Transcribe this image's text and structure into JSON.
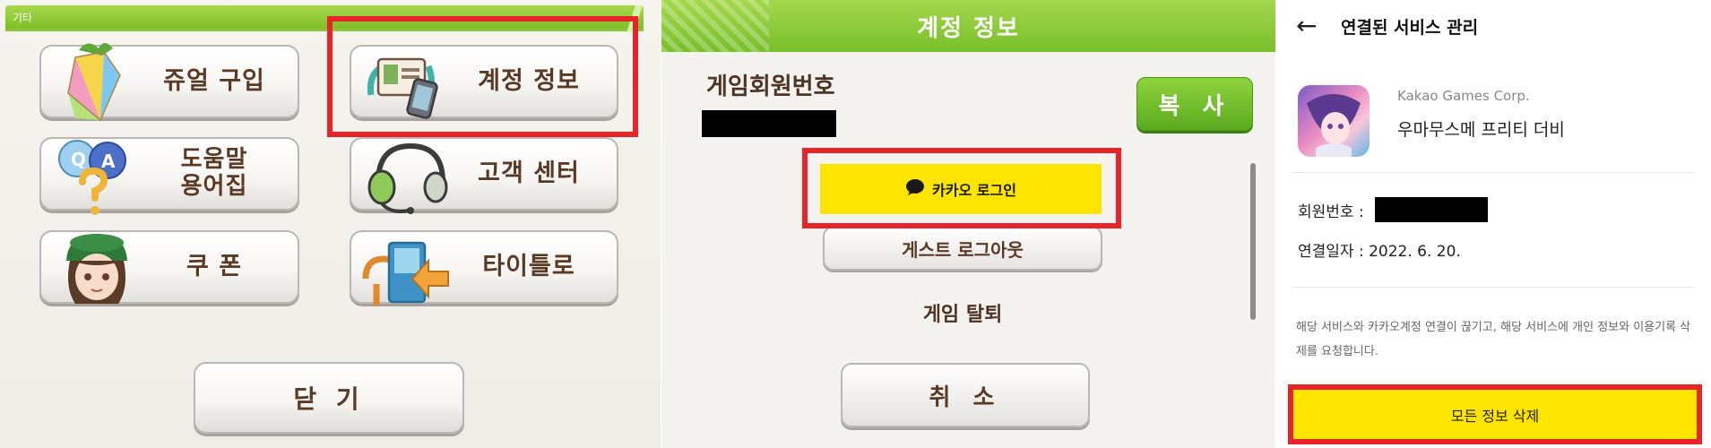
{
  "panel1": {
    "section_label": "기타",
    "buttons": {
      "jewel_purchase": "쥬얼 구입",
      "account_info": "계정 정보",
      "help_line1": "도움말",
      "help_line2": "용어집",
      "customer_center": "고객 센터",
      "coupon": "쿠 폰",
      "to_title": "타이틀로"
    },
    "close_label": "닫 기",
    "highlight_color": "#e8242a"
  },
  "panel2": {
    "title": "계정 정보",
    "member_number_label": "게임회원번호",
    "copy_label": "복 사",
    "kakao_login_label": "카카오 로그인",
    "guest_logout_label": "게스트 로그아웃",
    "withdraw_label": "게임 탈퇴",
    "cancel_label": "취 소",
    "accent_color": "#78bf2a"
  },
  "panel3": {
    "title": "연결된 서비스 관리",
    "company": "Kakao Games Corp.",
    "app_name": "우마무스메 프리티 더비",
    "member_number_label": "회원번호 :",
    "connected_date": "연결일자 : 2022. 6. 20.",
    "notice": "해당 서비스와 카카오계정 연결이 끊기고, 해당 서비스에 개인 정보와 이용기록 삭제를 요청합니다.",
    "delete_all_label": "모든 정보 삭제",
    "kakao_yellow": "#fee500"
  }
}
